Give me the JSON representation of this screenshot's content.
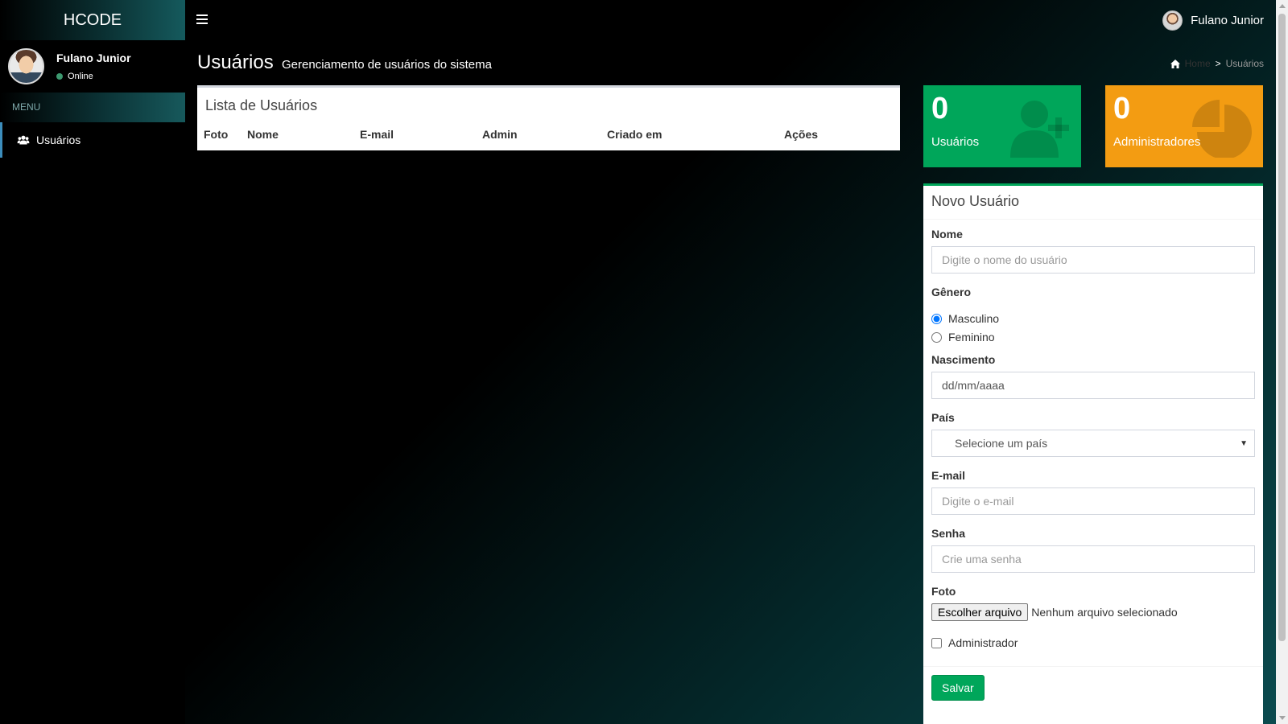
{
  "app": {
    "logo": "HCODE"
  },
  "header": {
    "user_name": "Fulano Junior"
  },
  "sidebar": {
    "user_name": "Fulano Junior",
    "status": "Online",
    "menu_header": "MENU",
    "items": [
      {
        "label": "Usuários",
        "icon": "users-icon"
      }
    ]
  },
  "content": {
    "title": "Usuários",
    "subtitle": "Gerenciamento de usuários do sistema",
    "breadcrumb": {
      "home": "Home",
      "separator": ">",
      "current": "Usuários"
    }
  },
  "users_box": {
    "title": "Lista de Usuários",
    "columns": [
      "Foto",
      "Nome",
      "E-mail",
      "Admin",
      "Criado em",
      "Ações"
    ]
  },
  "stats": {
    "users": {
      "count": "0",
      "label": "Usuários",
      "icon": "user-plus-icon",
      "color": "#00a65a"
    },
    "admins": {
      "count": "0",
      "label": "Administradores",
      "icon": "pie-chart-icon",
      "color": "#f39c12"
    }
  },
  "form": {
    "title": "Novo Usuário",
    "name_label": "Nome",
    "name_placeholder": "Digite o nome do usuário",
    "gender_label": "Gênero",
    "gender_options": [
      "Masculino",
      "Feminino"
    ],
    "gender_selected": "Masculino",
    "birth_label": "Nascimento",
    "birth_placeholder": "dd/mm/aaaa",
    "country_label": "País",
    "country_selected": "Selecione um país",
    "email_label": "E-mail",
    "email_placeholder": "Digite o e-mail",
    "password_label": "Senha",
    "password_placeholder": "Crie uma senha",
    "photo_label": "Foto",
    "photo_button": "Escolher arquivo",
    "photo_status": "Nenhum arquivo selecionado",
    "admin_label": "Administrador",
    "admin_checked": false,
    "save_label": "Salvar"
  },
  "colors": {
    "primary_green": "#00a65a",
    "orange": "#f39c12",
    "sidebar_accent": "#3c8dbc"
  }
}
